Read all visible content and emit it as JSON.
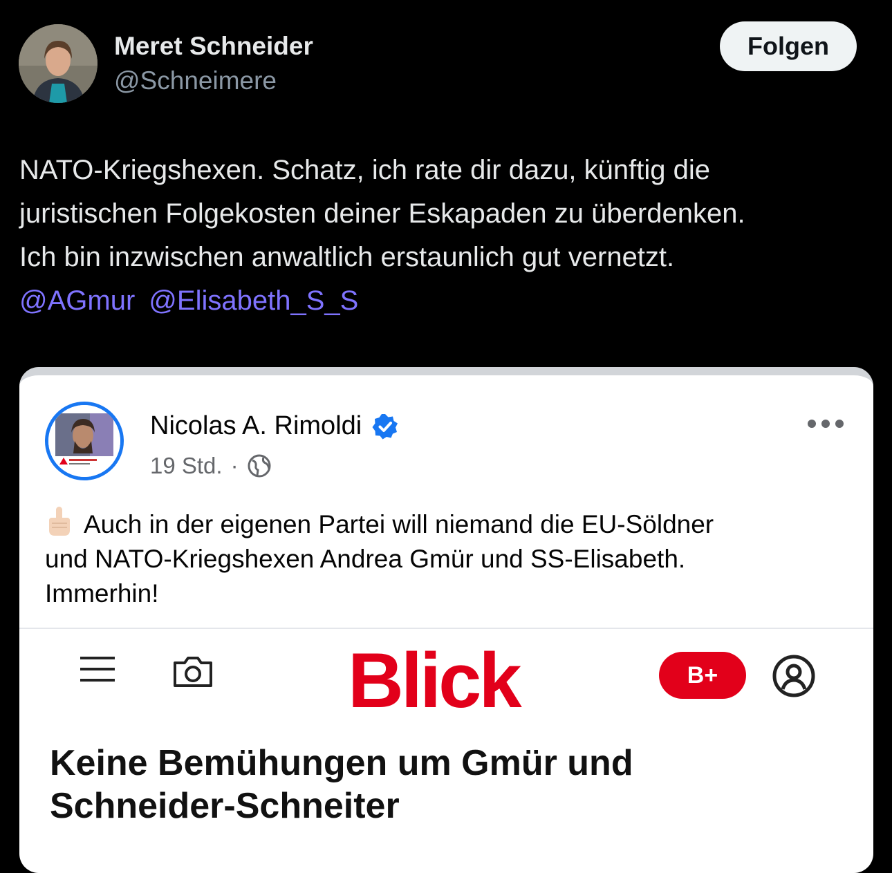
{
  "tweet": {
    "author_name": "Meret Schneider",
    "author_handle": "@Schneimere",
    "follow_label": "Folgen",
    "text_lines": [
      "NATO-Kriegshexen. Schatz, ich rate dir dazu, künftig die",
      "juristischen Folgekosten deiner Eskapaden zu überdenken.",
      "Ich bin inzwischen anwaltlich erstaunlich gut vernetzt."
    ],
    "mentions": [
      "@AGmur",
      "@Elisabeth_S_S"
    ],
    "mention_color": "#7f73ff"
  },
  "embedded_post": {
    "author_name": "Nicolas A. Rimoldi",
    "time": "19 Std.",
    "separator": "·",
    "icons": [
      "verified-badge-icon",
      "globe-icon",
      "more-options-icon",
      "middle-finger-emoji"
    ],
    "text_lines": [
      "Auch in der eigenen Partei will niemand die EU-Söldner",
      "und NATO-Kriegshexen Andrea Gmür und SS-Elisabeth.",
      "Immerhin!"
    ],
    "article": {
      "brand": "Blick",
      "brand_color": "#e2001a",
      "plus_label": "B+",
      "icons": [
        "menu-icon",
        "camera-icon",
        "user-account-icon"
      ],
      "headline_lines": [
        "Keine Bemühungen um Gmür und",
        "Schneider-Schneiter"
      ]
    }
  }
}
